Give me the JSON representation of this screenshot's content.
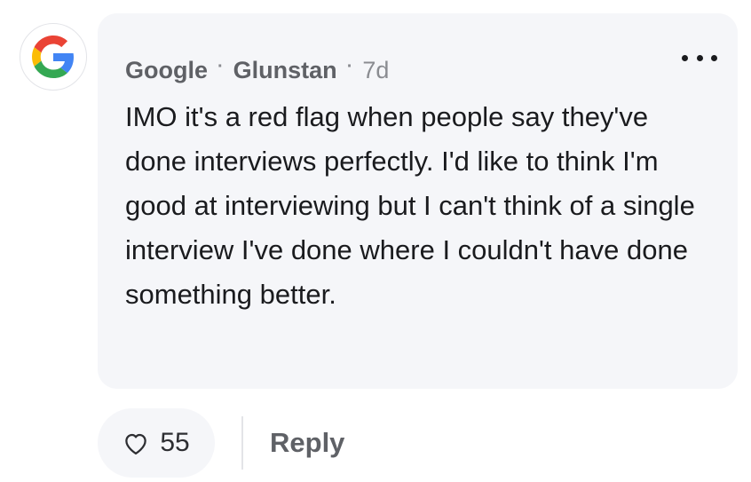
{
  "comment": {
    "avatar_icon": "google-g-logo",
    "company": "Google",
    "separator": "·",
    "author": "Glunstan",
    "time": "7d",
    "text": "IMO it's a red flag when people say they've done interviews perfectly. I'd like to think I'm good at interviewing but I can't think of a single interview I've done where I couldn't have done something better.",
    "more_icon": "more-horizontal-icon"
  },
  "actions": {
    "like_icon": "heart-icon",
    "like_count": "55",
    "reply_label": "Reply"
  },
  "colors": {
    "bubble_bg": "#f5f6f9",
    "text": "#1a1b1e",
    "meta": "#5f6166",
    "google_blue": "#4285F4",
    "google_red": "#EA4335",
    "google_yellow": "#FBBC05",
    "google_green": "#34A853"
  }
}
